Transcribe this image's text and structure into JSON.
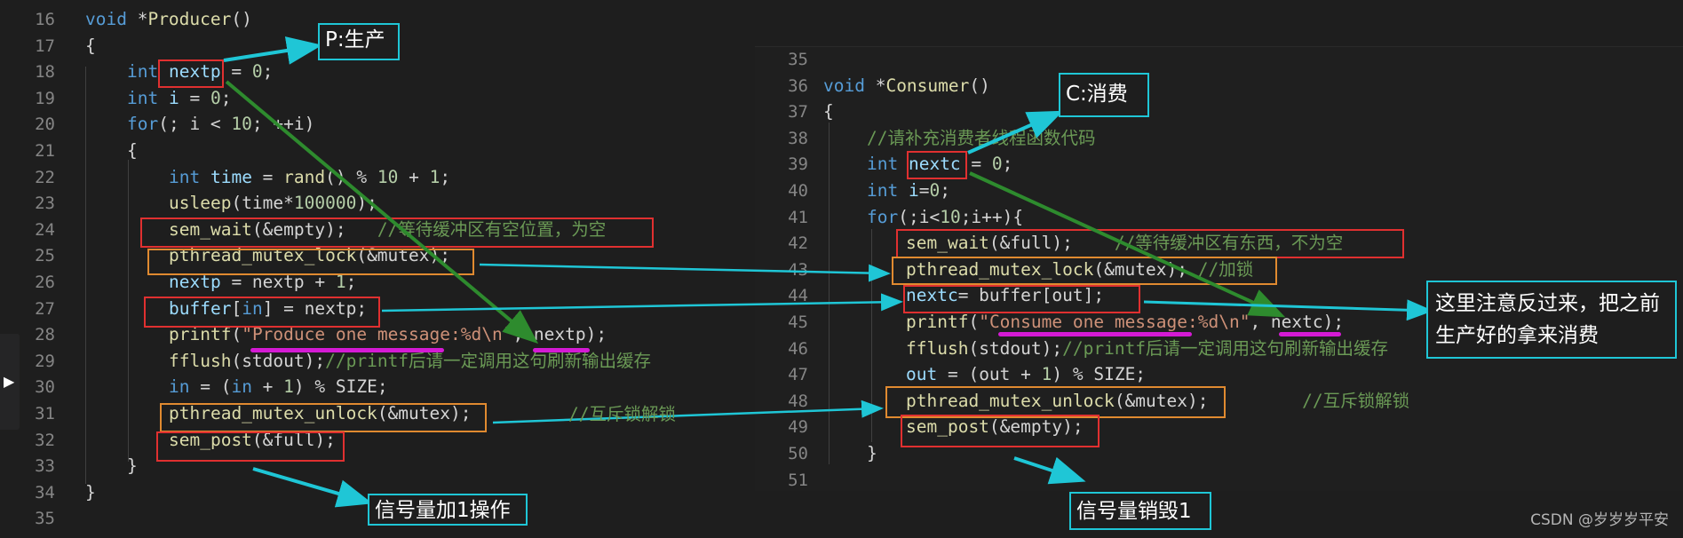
{
  "left": {
    "gutter": [
      "16",
      "17",
      "18",
      "19",
      "20",
      "21",
      "22",
      "23",
      "24",
      "25",
      "26",
      "27",
      "28",
      "29",
      "30",
      "31",
      "32",
      "33",
      "34",
      "35"
    ],
    "lines": [
      {
        "segs": [
          {
            "c": "kw",
            "t": "void "
          },
          {
            "c": "txt",
            "t": "*"
          },
          {
            "c": "fn",
            "t": "Producer"
          },
          {
            "c": "txt",
            "t": "()"
          }
        ]
      },
      {
        "segs": [
          {
            "c": "txt",
            "t": "{"
          }
        ]
      },
      {
        "segs": [
          {
            "c": "kw",
            "t": "int "
          },
          {
            "c": "var",
            "t": "nextp"
          },
          {
            "c": "txt",
            "t": " = "
          },
          {
            "c": "num",
            "t": "0"
          },
          {
            "c": "txt",
            "t": ";"
          }
        ]
      },
      {
        "segs": [
          {
            "c": "kw",
            "t": "int "
          },
          {
            "c": "var",
            "t": "i"
          },
          {
            "c": "txt",
            "t": " = "
          },
          {
            "c": "num",
            "t": "0"
          },
          {
            "c": "txt",
            "t": ";"
          }
        ]
      },
      {
        "segs": [
          {
            "c": "kw",
            "t": "for"
          },
          {
            "c": "txt",
            "t": "(; i < "
          },
          {
            "c": "num",
            "t": "10"
          },
          {
            "c": "txt",
            "t": "; ++i)"
          }
        ]
      },
      {
        "segs": [
          {
            "c": "txt",
            "t": "{"
          }
        ]
      },
      {
        "segs": [
          {
            "c": "kw",
            "t": "int "
          },
          {
            "c": "var",
            "t": "time"
          },
          {
            "c": "txt",
            "t": " = "
          },
          {
            "c": "fn",
            "t": "rand"
          },
          {
            "c": "txt",
            "t": "() % "
          },
          {
            "c": "num",
            "t": "10"
          },
          {
            "c": "txt",
            "t": " + "
          },
          {
            "c": "num",
            "t": "1"
          },
          {
            "c": "txt",
            "t": ";"
          }
        ]
      },
      {
        "segs": [
          {
            "c": "fn",
            "t": "usleep"
          },
          {
            "c": "txt",
            "t": "(time*"
          },
          {
            "c": "num",
            "t": "100000"
          },
          {
            "c": "txt",
            "t": ");"
          }
        ]
      },
      {
        "segs": [
          {
            "c": "fn",
            "t": "sem_wait"
          },
          {
            "c": "txt",
            "t": "(&empty);   "
          },
          {
            "c": "cm",
            "t": "//等待缓冲区有空位置，为空"
          }
        ]
      },
      {
        "segs": [
          {
            "c": "fn",
            "t": "pthread_mutex_lock"
          },
          {
            "c": "txt",
            "t": "(&mutex);"
          }
        ]
      },
      {
        "segs": [
          {
            "c": "var",
            "t": "nextp"
          },
          {
            "c": "txt",
            "t": " = nextp + "
          },
          {
            "c": "num",
            "t": "1"
          },
          {
            "c": "txt",
            "t": ";"
          }
        ]
      },
      {
        "segs": [
          {
            "c": "var",
            "t": "buffer"
          },
          {
            "c": "txt",
            "t": "["
          },
          {
            "c": "kw",
            "t": "in"
          },
          {
            "c": "txt",
            "t": "] = nextp;"
          }
        ]
      },
      {
        "segs": [
          {
            "c": "fn",
            "t": "printf"
          },
          {
            "c": "txt",
            "t": "("
          },
          {
            "c": "str",
            "t": "\"Produce one message:%d\\n\""
          },
          {
            "c": "txt",
            "t": ", nextp);"
          }
        ]
      },
      {
        "segs": [
          {
            "c": "fn",
            "t": "fflush"
          },
          {
            "c": "txt",
            "t": "(stdout);"
          },
          {
            "c": "cm",
            "t": "//printf后请一定调用这句刷新输出缓存"
          }
        ]
      },
      {
        "segs": [
          {
            "c": "kw",
            "t": "in"
          },
          {
            "c": "txt",
            "t": " = ("
          },
          {
            "c": "kw",
            "t": "in"
          },
          {
            "c": "txt",
            "t": " + "
          },
          {
            "c": "num",
            "t": "1"
          },
          {
            "c": "txt",
            "t": ") % SIZE;"
          }
        ]
      },
      {
        "segs": [
          {
            "c": "fn",
            "t": "pthread_mutex_unlock"
          },
          {
            "c": "txt",
            "t": "(&mutex);"
          }
        ]
      },
      {
        "segs": [
          {
            "c": "fn",
            "t": "sem_post"
          },
          {
            "c": "txt",
            "t": "(&full);"
          }
        ]
      },
      {
        "segs": [
          {
            "c": "txt",
            "t": "}"
          }
        ]
      },
      {
        "segs": [
          {
            "c": "txt",
            "t": "}"
          }
        ]
      },
      {
        "segs": []
      }
    ],
    "mid_comment": "//互斥锁解锁"
  },
  "right": {
    "gutter": [
      "35",
      "36",
      "37",
      "38",
      "39",
      "40",
      "41",
      "42",
      "43",
      "44",
      "45",
      "46",
      "47",
      "48",
      "49",
      "50",
      "51"
    ],
    "lines": [
      {
        "segs": []
      },
      {
        "segs": [
          {
            "c": "kw",
            "t": "void "
          },
          {
            "c": "txt",
            "t": "*"
          },
          {
            "c": "fn",
            "t": "Consumer"
          },
          {
            "c": "txt",
            "t": "()"
          }
        ]
      },
      {
        "segs": [
          {
            "c": "txt",
            "t": "{"
          }
        ]
      },
      {
        "segs": [
          {
            "c": "cm",
            "t": "//请补充消费者线程函数代码"
          }
        ]
      },
      {
        "segs": [
          {
            "c": "kw",
            "t": "int "
          },
          {
            "c": "var",
            "t": "nextc"
          },
          {
            "c": "txt",
            "t": " = "
          },
          {
            "c": "num",
            "t": "0"
          },
          {
            "c": "txt",
            "t": ";"
          }
        ]
      },
      {
        "segs": [
          {
            "c": "kw",
            "t": "int "
          },
          {
            "c": "var",
            "t": "i"
          },
          {
            "c": "txt",
            "t": "="
          },
          {
            "c": "num",
            "t": "0"
          },
          {
            "c": "txt",
            "t": ";"
          }
        ]
      },
      {
        "segs": [
          {
            "c": "kw",
            "t": "for"
          },
          {
            "c": "txt",
            "t": "(;i<"
          },
          {
            "c": "num",
            "t": "10"
          },
          {
            "c": "txt",
            "t": ";i++){"
          }
        ]
      },
      {
        "segs": [
          {
            "c": "fn",
            "t": "sem_wait"
          },
          {
            "c": "txt",
            "t": "(&full);    "
          },
          {
            "c": "cm",
            "t": "//等待缓冲区有东西，不为空"
          }
        ]
      },
      {
        "segs": [
          {
            "c": "fn",
            "t": "pthread_mutex_lock"
          },
          {
            "c": "txt",
            "t": "(&mutex); "
          },
          {
            "c": "cm",
            "t": "//加锁"
          }
        ]
      },
      {
        "segs": [
          {
            "c": "var",
            "t": "nextc"
          },
          {
            "c": "txt",
            "t": "= buffer[out];"
          }
        ]
      },
      {
        "segs": [
          {
            "c": "fn",
            "t": "printf"
          },
          {
            "c": "txt",
            "t": "("
          },
          {
            "c": "str",
            "t": "\"Consume one message:%d\\n\""
          },
          {
            "c": "txt",
            "t": ", nextc);"
          }
        ]
      },
      {
        "segs": [
          {
            "c": "fn",
            "t": "fflush"
          },
          {
            "c": "txt",
            "t": "(stdout);"
          },
          {
            "c": "cm",
            "t": "//printf后请一定调用这句刷新输出缓存"
          }
        ]
      },
      {
        "segs": [
          {
            "c": "var",
            "t": "out"
          },
          {
            "c": "txt",
            "t": " = (out + "
          },
          {
            "c": "num",
            "t": "1"
          },
          {
            "c": "txt",
            "t": ") % SIZE;"
          }
        ]
      },
      {
        "segs": [
          {
            "c": "fn",
            "t": "pthread_mutex_unlock"
          },
          {
            "c": "txt",
            "t": "(&mutex);         "
          },
          {
            "c": "cm",
            "t": "//互斥锁解锁"
          }
        ]
      },
      {
        "segs": [
          {
            "c": "fn",
            "t": "sem_post"
          },
          {
            "c": "txt",
            "t": "(&empty);"
          }
        ]
      },
      {
        "segs": [
          {
            "c": "txt",
            "t": "}"
          }
        ]
      },
      {
        "segs": []
      }
    ]
  },
  "labels": {
    "p": "P:生产",
    "c": "C:消费",
    "sem_add": "信号量加1操作",
    "sem_destroy": "信号量销毁1",
    "note_line1": "这里注意反过来，把之前",
    "note_line2": "生产好的拿来消费"
  },
  "watermark": "CSDN @岁岁岁平安",
  "colors": {
    "red": "#e03030",
    "orange": "#e08a30",
    "cyan": "#1fc6d6",
    "green": "#2e8b2e",
    "magenta": "#d41ad4"
  }
}
